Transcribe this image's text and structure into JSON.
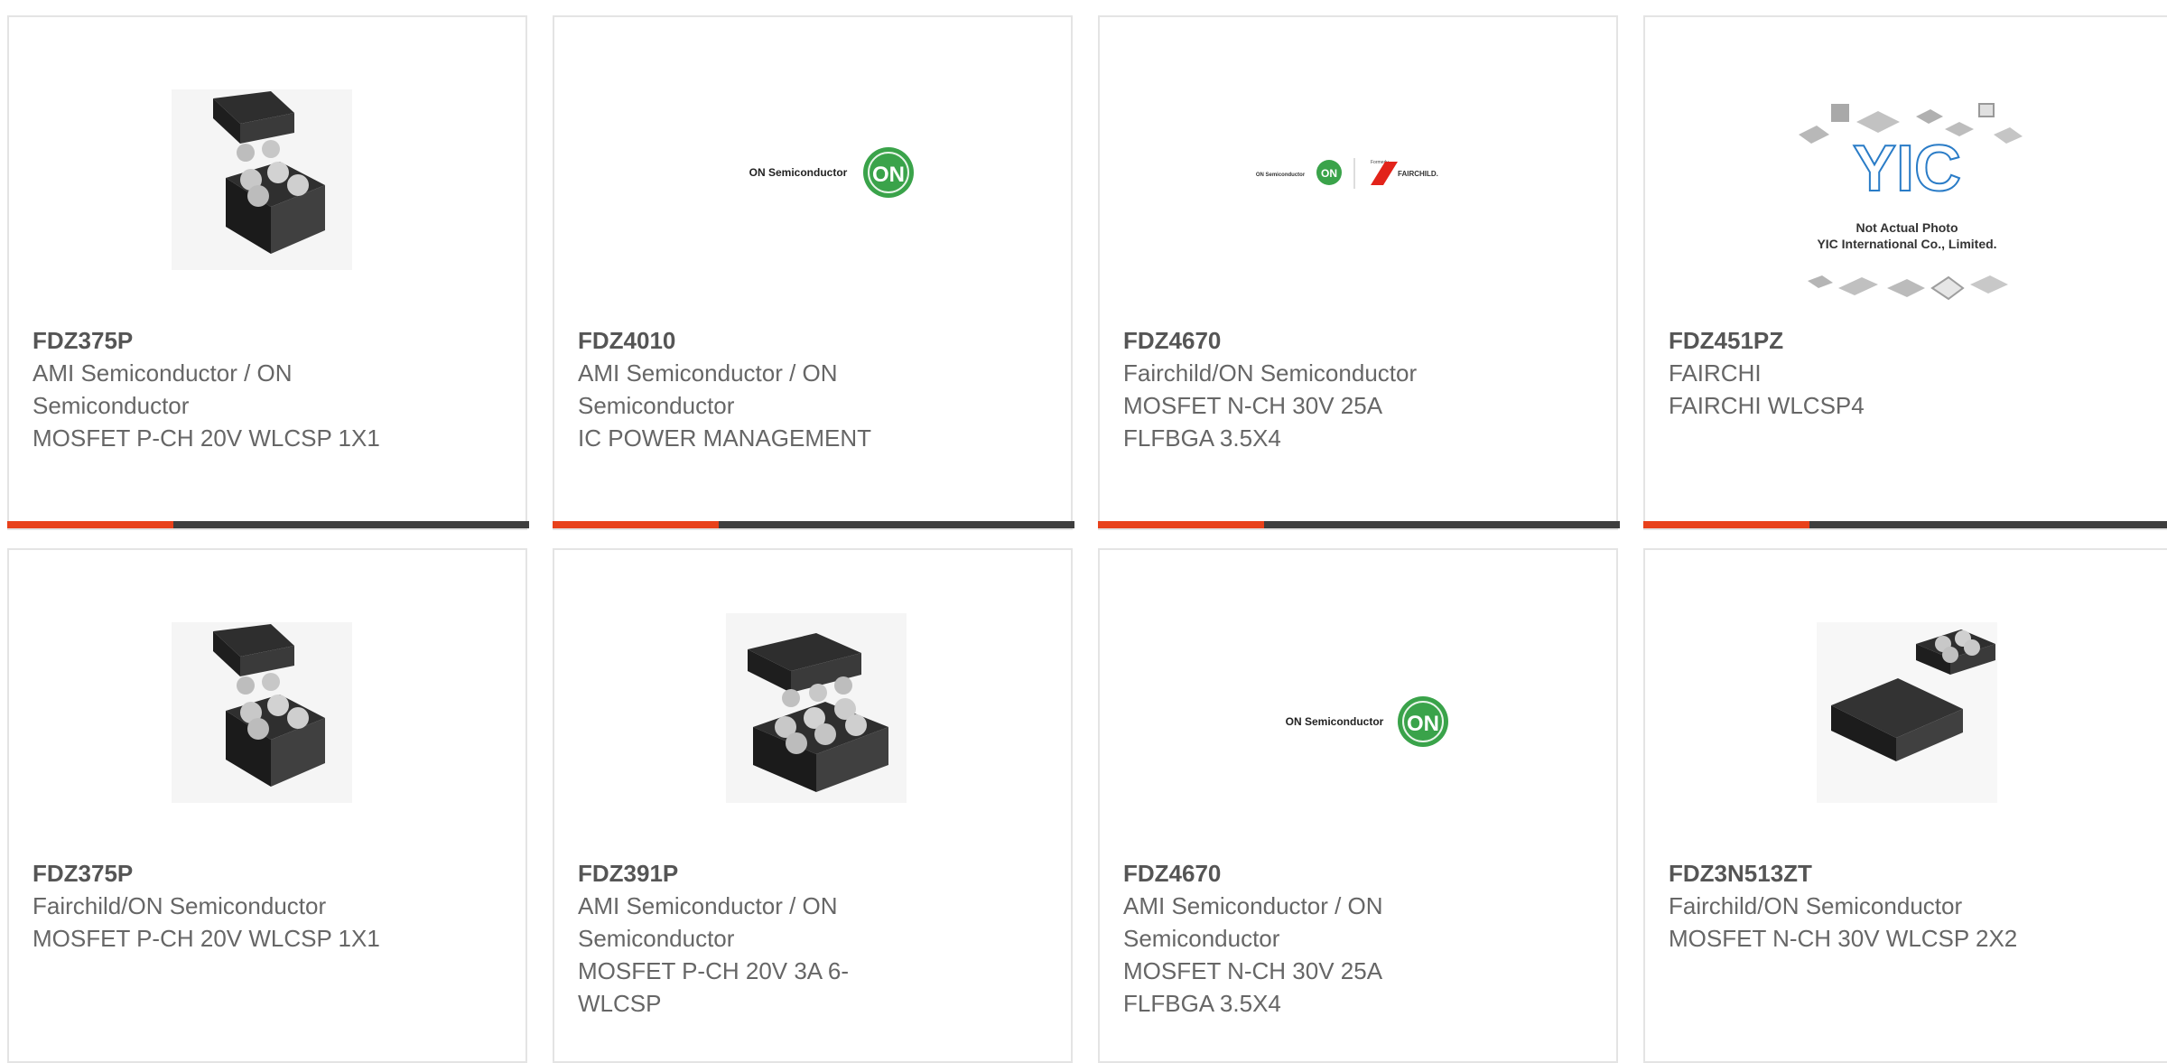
{
  "products": [
    {
      "part": "FDZ375P",
      "lines": [
        "AMI Semiconductor / ON",
        "Semiconductor",
        "MOSFET P-CH 20V WLCSP 1X1"
      ],
      "image": "chip-icon-a"
    },
    {
      "part": "FDZ4010",
      "lines": [
        "AMI Semiconductor / ON",
        "Semiconductor",
        "IC POWER MANAGEMENT"
      ],
      "image": "on-logo"
    },
    {
      "part": "FDZ4670",
      "lines": [
        "Fairchild/ON Semiconductor",
        "MOSFET N-CH 30V 25A",
        "FLFBGA 3.5X4"
      ],
      "image": "on-fairchild-logo"
    },
    {
      "part": "FDZ451PZ",
      "lines": [
        "FAIRCHI",
        "FAIRCHI WLCSP4"
      ],
      "image": "yic-placeholder"
    },
    {
      "part": "FDZ375P",
      "lines": [
        "Fairchild/ON Semiconductor",
        "MOSFET P-CH 20V WLCSP 1X1"
      ],
      "image": "chip-icon-a"
    },
    {
      "part": "FDZ391P",
      "lines": [
        "AMI Semiconductor / ON",
        "Semiconductor",
        "MOSFET P-CH 20V 3A 6-",
        "WLCSP"
      ],
      "image": "chip-icon-b"
    },
    {
      "part": "FDZ4670",
      "lines": [
        "AMI Semiconductor / ON",
        "Semiconductor",
        "MOSFET N-CH 30V 25A",
        "FLFBGA 3.5X4"
      ],
      "image": "on-logo"
    },
    {
      "part": "FDZ3N513ZT",
      "lines": [
        "Fairchild/ON Semiconductor",
        "MOSFET N-CH 30V WLCSP 2X2"
      ],
      "image": "chip-icon-c"
    }
  ],
  "logos": {
    "on_text": "ON Semiconductor",
    "on_badge": "ON",
    "fairchild_small": "Formerly",
    "fairchild_text": "FAIRCHILD.",
    "yic_line1": "Not Actual Photo",
    "yic_line2": "YIC International Co., Limited.",
    "yic_mark": "YIC"
  },
  "colors": {
    "accent": "#e8411b",
    "bar": "#3e3e3e",
    "on_green": "#3aa34a",
    "fairchild_red": "#e2231a",
    "yic_blue": "#2a7cc7"
  }
}
